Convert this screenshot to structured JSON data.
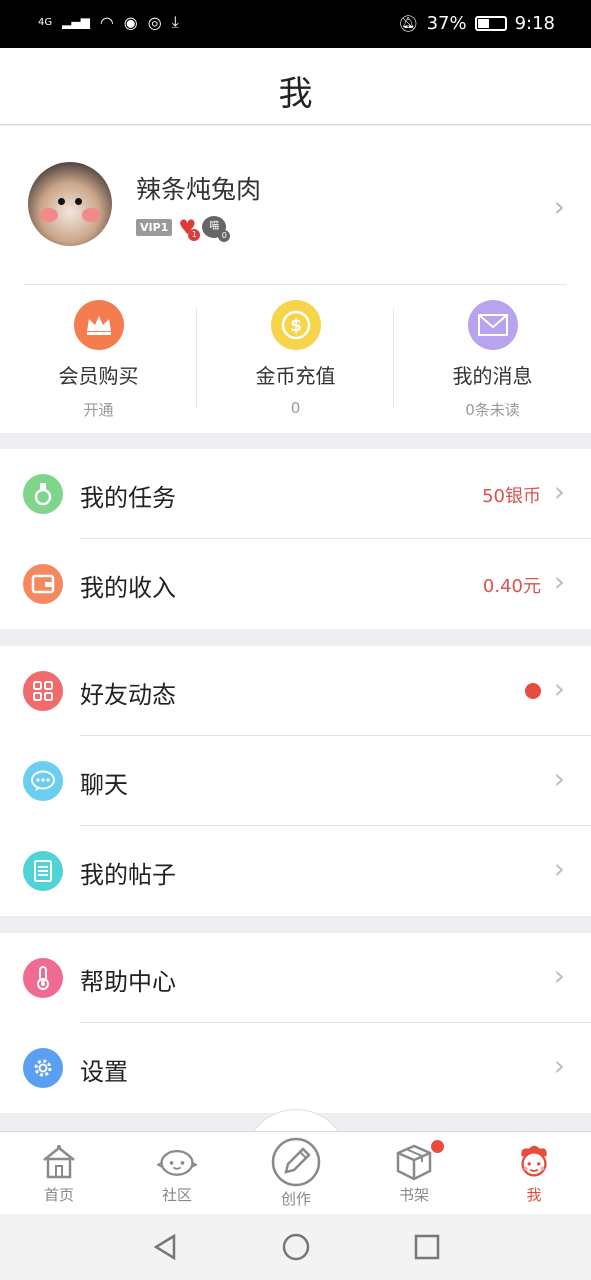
{
  "status_bar": {
    "network": "4G",
    "battery": "37%",
    "time": "9:18"
  },
  "header": {
    "title": "我"
  },
  "profile": {
    "username": "辣条炖兔肉",
    "vip_badge": "VIP1",
    "heart_count": "1",
    "cat_badge_label": "喵",
    "cat_count": "0"
  },
  "quick_actions": [
    {
      "label": "会员购买",
      "sub": "开通",
      "icon": "crown-icon",
      "color": "#f47c4e"
    },
    {
      "label": "金币充值",
      "sub": "0",
      "icon": "coin-icon",
      "color": "#f7d44c"
    },
    {
      "label": "我的消息",
      "sub": "0条未读",
      "icon": "envelope-icon",
      "color": "#b7a3ee"
    }
  ],
  "menu": {
    "tasks": {
      "label": "我的任务",
      "value": "50银币",
      "icon": "medal-icon",
      "color": "#7fd68a"
    },
    "income": {
      "label": "我的收入",
      "value": "0.40元",
      "icon": "wallet-icon",
      "color": "#f5885e"
    },
    "friends": {
      "label": "好友动态",
      "icon": "grid-icon",
      "color": "#f06b6b"
    },
    "chat": {
      "label": "聊天",
      "icon": "chat-bubble-icon",
      "color": "#6bcdf0"
    },
    "posts": {
      "label": "我的帖子",
      "icon": "document-icon",
      "color": "#4fd3d6"
    },
    "help": {
      "label": "帮助中心",
      "icon": "help-thermometer-icon",
      "color": "#f06b92"
    },
    "settings": {
      "label": "设置",
      "icon": "gear-icon",
      "color": "#5b9ff0"
    }
  },
  "tabs": [
    {
      "label": "首页",
      "icon": "house-icon"
    },
    {
      "label": "社区",
      "icon": "face-bubble-icon"
    },
    {
      "label": "创作",
      "icon": "pencil-icon"
    },
    {
      "label": "书架",
      "icon": "box-icon"
    },
    {
      "label": "我",
      "icon": "character-icon",
      "active_color": "#e84c3d"
    }
  ]
}
